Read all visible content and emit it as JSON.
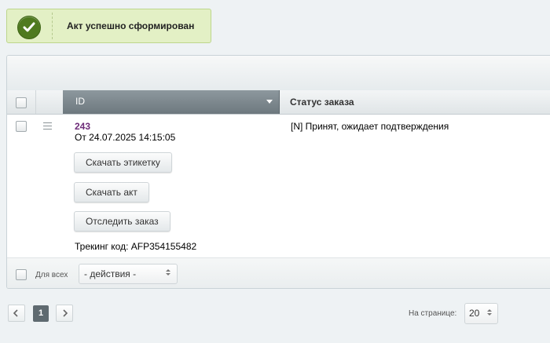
{
  "notification": {
    "text": "Акт успешно сформирован",
    "icon": "check-icon",
    "color": "#4f7a1f"
  },
  "grid": {
    "columns": {
      "id": "ID",
      "status": "Статус заказа"
    },
    "row": {
      "order_id": "243",
      "date": "От 24.07.2025 14:15:05",
      "status": "[N] Принят, ожидает подтверждения",
      "buttons": {
        "download_label": "Скачать этикетку",
        "download_act": "Скачать акт",
        "track_order": "Отследить заказ"
      },
      "tracking": "Трекинг код: AFP354155482"
    },
    "footer": {
      "for_all": "Для всех",
      "actions_select": "- действия -"
    }
  },
  "pager": {
    "current_page": "1",
    "per_page_label": "На странице:",
    "per_page_value": "20"
  }
}
